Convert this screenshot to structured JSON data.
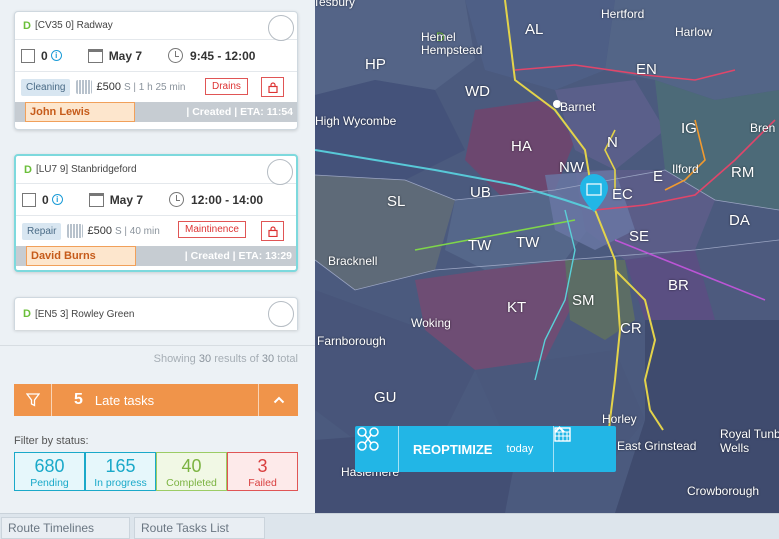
{
  "tasks": [
    {
      "status_letter": "D",
      "code": "[CV35 0] Radway",
      "count": "0",
      "date": "May 7",
      "time": "9:45 - 12:00",
      "type": "Cleaning",
      "price": "£500",
      "size_dur": "S | 1 h 25 min",
      "category": "Drains",
      "assignee": "John Lewis",
      "eta": "| Created | ETA: 11:54"
    },
    {
      "status_letter": "D",
      "code": "[LU7 9] Stanbridgeford",
      "count": "0",
      "date": "May 7",
      "time": "12:00 - 14:00",
      "type": "Repair",
      "price": "£500",
      "size_dur": "S | 40 min",
      "category": "Maintinence",
      "assignee": "David Burns",
      "eta": "| Created | ETA: 13:29"
    },
    {
      "status_letter": "D",
      "code": "[EN5 3] Rowley Green"
    }
  ],
  "showing": {
    "prefix": "Showing",
    "count": "30",
    "middle": "results of",
    "total": "30",
    "suffix": "total"
  },
  "late": {
    "count": "5",
    "label": "Late tasks"
  },
  "filter_label": "Filter by status:",
  "stats": [
    {
      "num": "680",
      "label": "Pending",
      "color": "#1aa9c9"
    },
    {
      "num": "165",
      "label": "In progress",
      "color": "#1aa9c9"
    },
    {
      "num": "40",
      "label": "Completed",
      "color": "#7cb342"
    },
    {
      "num": "3",
      "label": "Failed",
      "color": "#d94040"
    }
  ],
  "tabs": [
    "Route Timelines",
    "Route Tasks List"
  ],
  "map_labels": [
    "Tesbury",
    "Hertford",
    "AL",
    "Harlow",
    "D",
    "Hemel Hempstead",
    "HP",
    "EN",
    "WD",
    "Barnet",
    "High Wycombe",
    "IG",
    "Bren",
    "HA",
    "N",
    "NW",
    "E",
    "Ilford",
    "RM",
    "UB",
    "EC",
    "SL",
    "DA",
    "SE",
    "TW",
    "TW",
    "Bracknell",
    "BR",
    "KT",
    "SM",
    "Woking",
    "CR",
    "Farnborough",
    "GU",
    "Horley",
    "East Grinstead",
    "Royal Tunb Wells",
    "Haslemere",
    "Crowborough"
  ],
  "reoptimize": {
    "title": "REOPTIMIZE",
    "sub": "today"
  },
  "colors": {
    "accent": "#22b6e6",
    "late": "#f0944a",
    "map_bg": "#4b5a7e"
  }
}
